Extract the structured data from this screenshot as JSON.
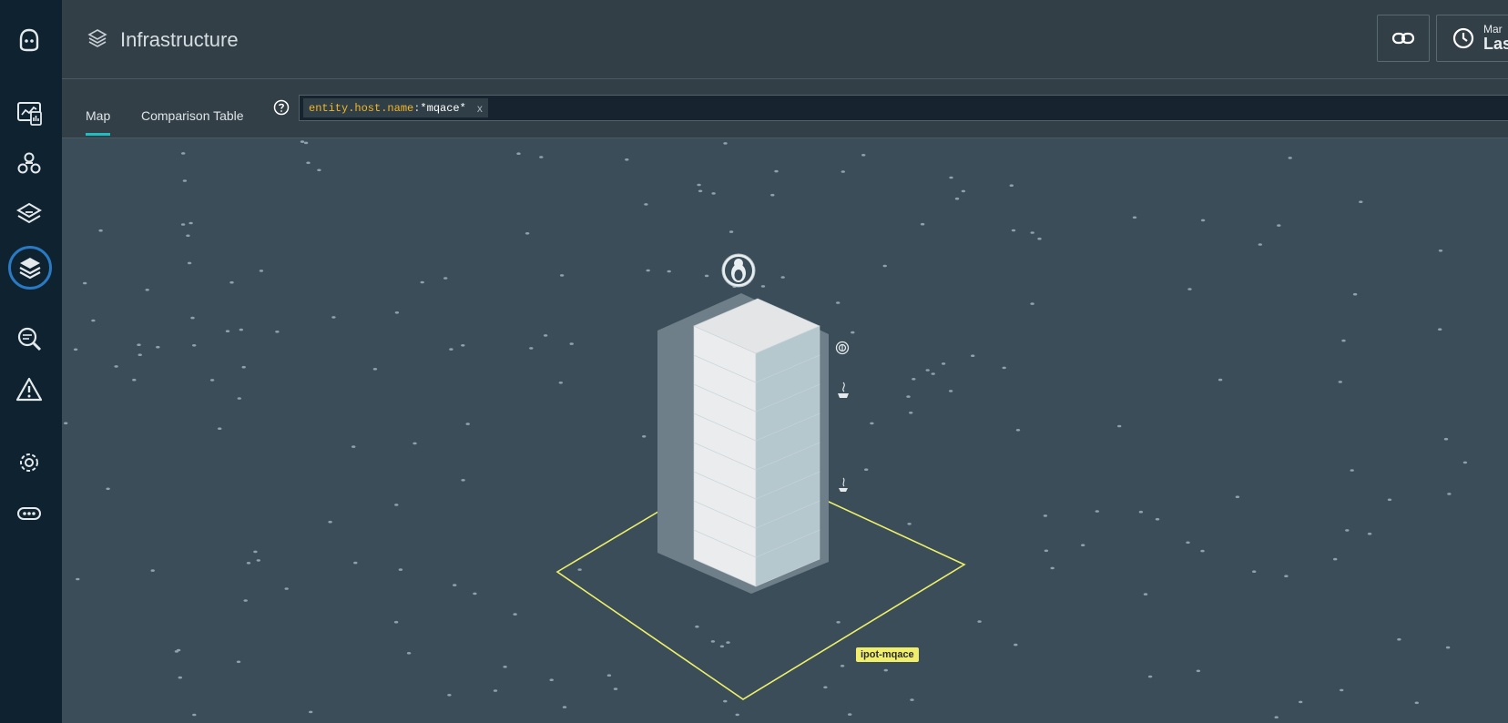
{
  "header": {
    "title": "Infrastructure",
    "time_date": "Mar",
    "time_range": "Las"
  },
  "tabs": [
    {
      "label": "Map",
      "active": true
    },
    {
      "label": "Comparison Table",
      "active": false
    }
  ],
  "search": {
    "key": "entity.host.name",
    "separator": ":",
    "value": "*mqace*",
    "remove": "x"
  },
  "map": {
    "host_label": "ipot-mqace",
    "os_icon": "linux-penguin-icon",
    "process_icons": [
      "fingerprint-icon",
      "java-icon"
    ]
  },
  "sidebar": {
    "items": [
      {
        "name": "logo-icon"
      },
      {
        "name": "dashboards-icon"
      },
      {
        "name": "applications-icon"
      },
      {
        "name": "platforms-icon"
      },
      {
        "name": "infrastructure-icon",
        "active": true
      },
      {
        "name": "analytics-icon"
      },
      {
        "name": "events-icon"
      },
      {
        "name": "settings-icon"
      },
      {
        "name": "more-icon"
      }
    ]
  },
  "colors": {
    "sidebar_bg": "#0f2230",
    "header_bg": "#333f47",
    "map_bg": "#3a4d58",
    "accent_tab": "#1fbcc1",
    "active_ring": "#2a79c2",
    "selection": "#f0ee6b",
    "query_key": "#f2b824"
  }
}
